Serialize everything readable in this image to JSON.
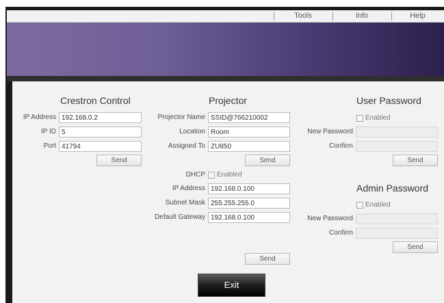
{
  "menu": {
    "tools": "Tools",
    "info": "Info",
    "help": "Help"
  },
  "crestron": {
    "title": "Crestron Control",
    "ip_label": "IP Address",
    "ip_value": "192.168.0.2",
    "ipid_label": "IP ID",
    "ipid_value": "5",
    "port_label": "Port",
    "port_value": "41794",
    "send": "Send"
  },
  "projector": {
    "title": "Projector",
    "name_label": "Projector Name",
    "name_value": "SSID@766210002",
    "location_label": "Location",
    "location_value": "Room",
    "assigned_label": "Assigned To",
    "assigned_value": "ZU850",
    "send1": "Send",
    "dhcp_label": "DHCP",
    "dhcp_enabled": "Enabled",
    "ip_label": "IP Address",
    "ip_value": "192.168.0.100",
    "subnet_label": "Subnet Mask",
    "subnet_value": "255.255.255.0",
    "gateway_label": "Default Gateway",
    "gateway_value": "192.168.0.100",
    "send2": "Send"
  },
  "user_password": {
    "title": "User Password",
    "enabled": "Enabled",
    "new_label": "New Password",
    "confirm_label": "Confirm",
    "send": "Send"
  },
  "admin_password": {
    "title": "Admin Password",
    "enabled": "Enabled",
    "new_label": "New Password",
    "confirm_label": "Confirm",
    "send": "Send"
  },
  "exit": "Exit"
}
